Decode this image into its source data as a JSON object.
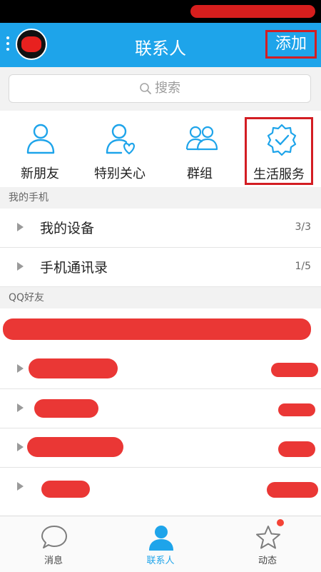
{
  "header": {
    "title": "联系人",
    "add_label": "添加"
  },
  "search": {
    "placeholder": "搜索"
  },
  "quick_actions": [
    {
      "label": "新朋友",
      "icon": "person-icon"
    },
    {
      "label": "特别关心",
      "icon": "person-heart-icon"
    },
    {
      "label": "群组",
      "icon": "group-icon"
    },
    {
      "label": "生活服务",
      "icon": "badge-check-icon"
    }
  ],
  "sections": {
    "my_phone": {
      "title": "我的手机",
      "rows": [
        {
          "label": "我的设备",
          "count": "3/3"
        },
        {
          "label": "手机通讯录",
          "count": "1/5"
        }
      ]
    },
    "qq_friends": {
      "title": "QQ好友"
    }
  },
  "tabs": [
    {
      "label": "消息",
      "icon": "chat-bubble-icon"
    },
    {
      "label": "联系人",
      "icon": "contacts-icon",
      "active": true
    },
    {
      "label": "动态",
      "icon": "star-icon",
      "badge": "red-dot"
    }
  ],
  "colors": {
    "brand": "#1ea4ea",
    "highlight": "#d31d23",
    "redaction": "#e8211f"
  }
}
